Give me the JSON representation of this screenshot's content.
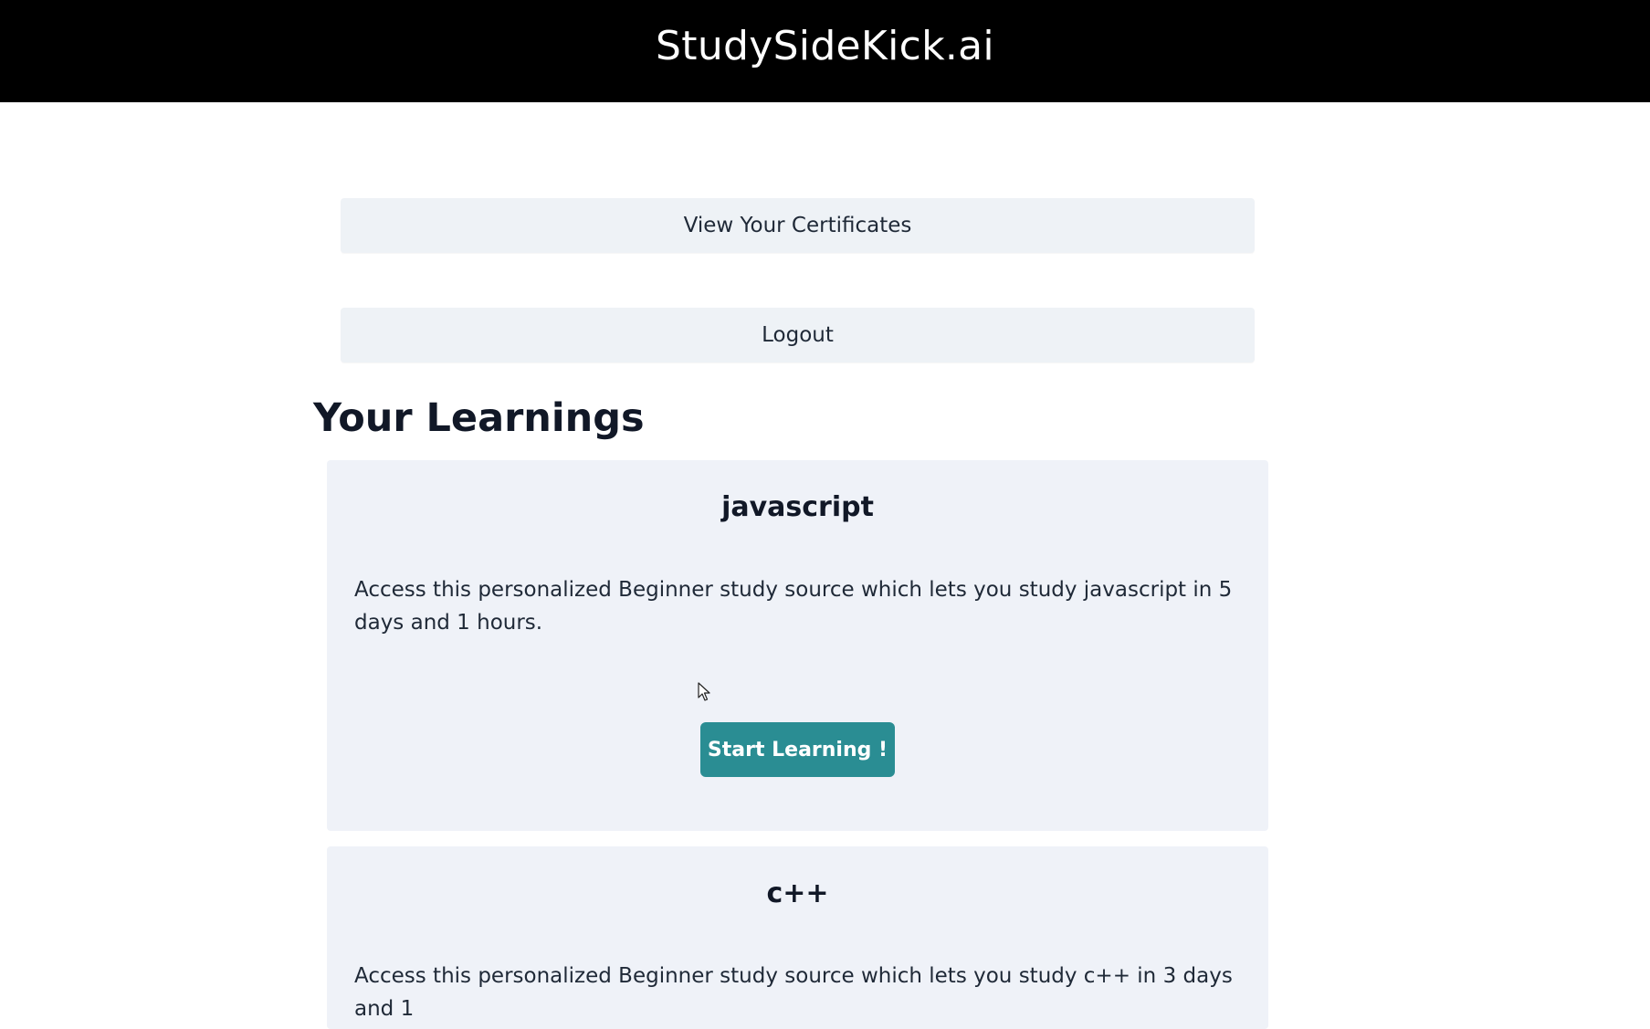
{
  "header": {
    "brand": "StudySideKick.ai"
  },
  "nav": {
    "certificates_label": "View Your Certificates",
    "logout_label": "Logout"
  },
  "main": {
    "section_title": "Your Learnings",
    "courses": [
      {
        "title": "javascript",
        "description": "Access this personalized Beginner study source which lets you study javascript in 5 days and 1 hours.",
        "button_label": "Start Learning !"
      },
      {
        "title": "c++",
        "description": "Access this personalized Beginner study source which lets you study c++ in 3 days and 1"
      }
    ]
  },
  "colors": {
    "header_bg": "#000000",
    "button_accent": "#2a8d93",
    "card_bg": "#eff2f8",
    "nav_button_bg": "#eef2f6"
  },
  "icons": {
    "cursor": "mouse-pointer-icon"
  }
}
